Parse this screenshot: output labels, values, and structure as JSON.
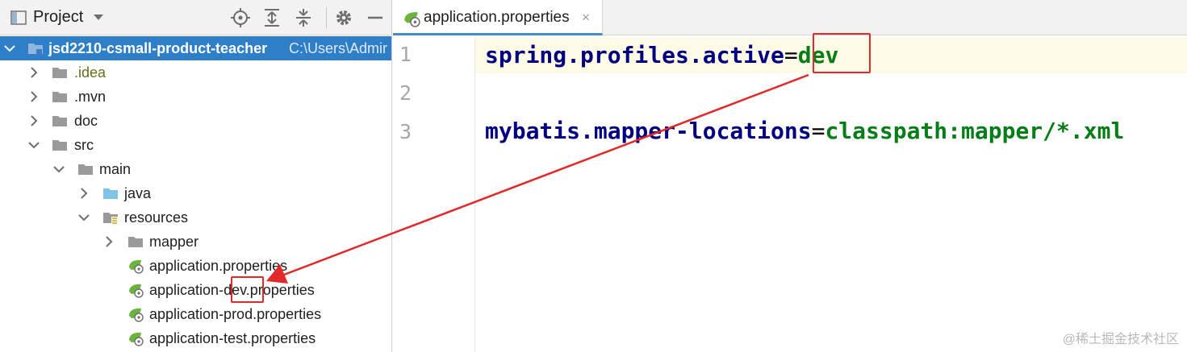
{
  "project_panel": {
    "title": "Project",
    "tree": {
      "root": {
        "name": "jsd2210-csmall-product-teacher",
        "path": "C:\\Users\\Admir"
      },
      "idea": ".idea",
      "mvn": ".mvn",
      "doc": "doc",
      "src": "src",
      "main": "main",
      "java": "java",
      "resources": "resources",
      "mapper": "mapper",
      "file1": "application.properties",
      "file2_prefix": "application-",
      "file2_highlight": "dev",
      "file2_suffix": ".properties",
      "file3": "application-prod.properties",
      "file4": "application-test.properties"
    }
  },
  "editor": {
    "tab_label": "application.properties",
    "tab_close": "×",
    "line_numbers": [
      "1",
      "2",
      "3"
    ],
    "line1": {
      "key": "spring.profiles.active",
      "eq": "=",
      "value": "dev"
    },
    "line3": {
      "key": "mybatis.mapper-locations",
      "eq": "=",
      "value": "classpath:mapper/*.xml"
    }
  },
  "watermark": "@稀土掘金技术社区",
  "icons": {
    "header": [
      "project-view-icon",
      "dropdown-arrow-icon",
      "locate-icon",
      "expand-all-icon",
      "collapse-all-icon",
      "gear-icon",
      "minimize-icon"
    ],
    "file": "spring-properties-icon",
    "folder": "folder-icon"
  },
  "colors": {
    "selection": "#2f7fc8",
    "key": "#000080",
    "value": "#067d17",
    "annotation": "#e22828",
    "caret_line": "#fdfbe5"
  }
}
